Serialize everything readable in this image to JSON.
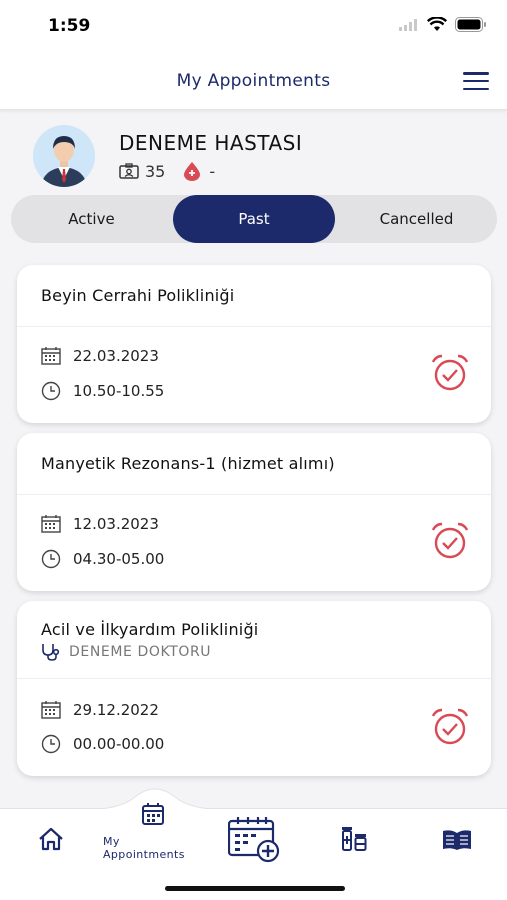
{
  "status": {
    "time": "1:59"
  },
  "header": {
    "title": "My Appointments",
    "menu_icon": "hamburger-menu-icon"
  },
  "profile": {
    "name": "DENEME HASTASI",
    "age": "35",
    "blood_type": "-",
    "avatar_icon": "user-avatar"
  },
  "tabs": [
    {
      "label": "Active",
      "selected": false
    },
    {
      "label": "Past",
      "selected": true
    },
    {
      "label": "Cancelled",
      "selected": false
    }
  ],
  "appointments": [
    {
      "title": "Beyin Cerrahi Polikliniği",
      "doctor": "",
      "date": "22.03.2023",
      "time": "10.50-10.55"
    },
    {
      "title": "Manyetik Rezonans-1 (hizmet alımı)",
      "doctor": "",
      "date": "12.03.2023",
      "time": "04.30-05.00"
    },
    {
      "title": "Acil ve İlkyardım Polikliniği",
      "doctor": "DENEME DOKTORU",
      "date": "29.12.2022",
      "time": "00.00-00.00"
    }
  ],
  "nav": {
    "active_label": "My Appointments",
    "items": [
      "home-icon",
      "calendar-icon",
      "calendar-add-icon",
      "medication-icon",
      "book-icon"
    ]
  },
  "colors": {
    "primary": "#1c2a6b",
    "alarm": "#d94a55",
    "blood": "#d94a55"
  }
}
